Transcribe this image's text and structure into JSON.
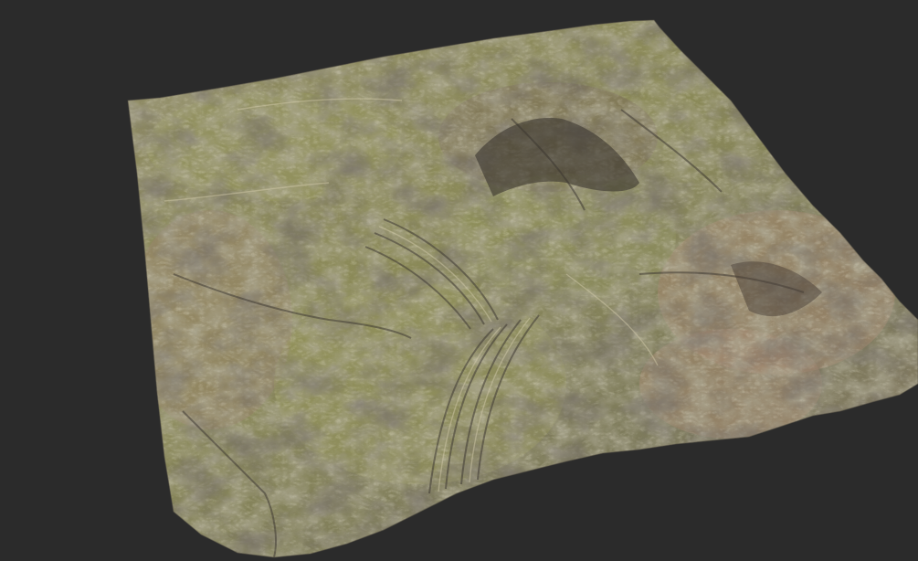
{
  "scene": {
    "background_color": "#2b2b2b",
    "subject": "terrain-mesh",
    "colors": {
      "grass": "#8a8a52",
      "grass_light": "#a3a46a",
      "rock": "#6f655a",
      "rock_dark": "#3e3832",
      "soil_pink": "#b08a78",
      "highlight": "#c9c2a6"
    }
  }
}
